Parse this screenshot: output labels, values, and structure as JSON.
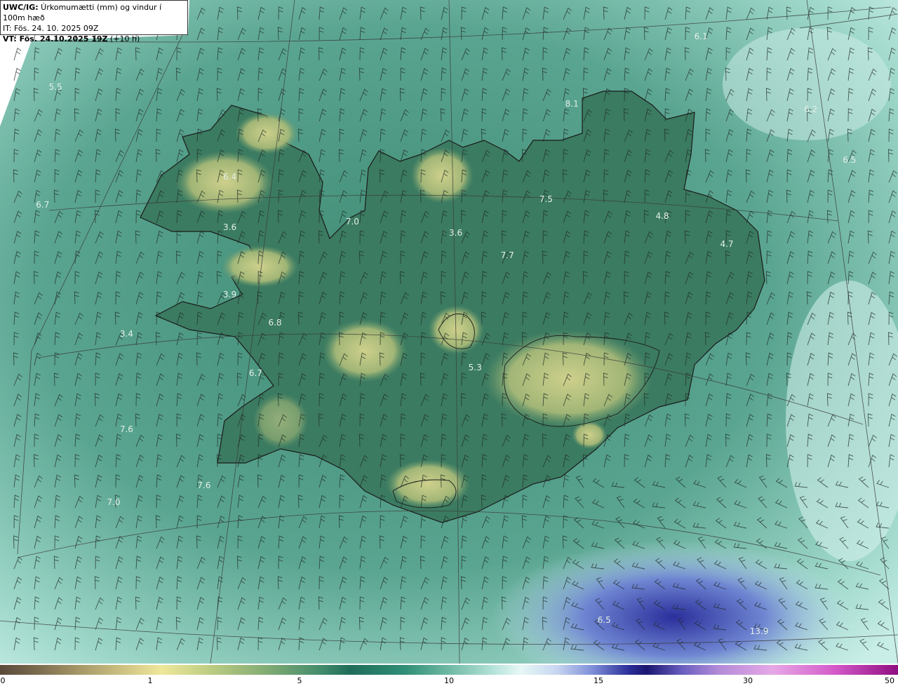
{
  "header": {
    "line1_bold": "UWC/IG:",
    "line1_rest": " Úrkomumætti (mm) og vindur í 100m hæð",
    "line2": "IT: Fös. 24. 10. 2025 09Z",
    "line3_bold": "VT: Fös. 24.10.2025 19Z",
    "line3_rest": " (+10 h)"
  },
  "value_labels": [
    {
      "text": "6.1",
      "lon": -14.9,
      "lat": 67.4
    },
    {
      "text": "5.5",
      "lon": -24.9,
      "lat": 66.95
    },
    {
      "text": "6.2",
      "lon": -13.2,
      "lat": 66.75
    },
    {
      "text": "6.5",
      "lon": -12.6,
      "lat": 66.3
    },
    {
      "text": "8.1",
      "lon": -16.9,
      "lat": 66.8
    },
    {
      "text": "6.4",
      "lon": -22.2,
      "lat": 66.15
    },
    {
      "text": "6.7",
      "lon": -25.1,
      "lat": 65.9
    },
    {
      "text": "3.6",
      "lon": -22.2,
      "lat": 65.7
    },
    {
      "text": "7.0",
      "lon": -20.3,
      "lat": 65.75
    },
    {
      "text": "3.6",
      "lon": -18.7,
      "lat": 65.65
    },
    {
      "text": "7.5",
      "lon": -17.3,
      "lat": 65.95
    },
    {
      "text": "4.8",
      "lon": -15.5,
      "lat": 65.8
    },
    {
      "text": "4.7",
      "lon": -14.5,
      "lat": 65.55
    },
    {
      "text": "7.7",
      "lon": -17.9,
      "lat": 65.45
    },
    {
      "text": "3.9",
      "lon": -22.2,
      "lat": 65.1
    },
    {
      "text": "6.8",
      "lon": -21.5,
      "lat": 64.85
    },
    {
      "text": "3.4",
      "lon": -23.8,
      "lat": 64.75
    },
    {
      "text": "5.3",
      "lon": -18.4,
      "lat": 64.45
    },
    {
      "text": "6.7",
      "lon": -21.8,
      "lat": 64.4
    },
    {
      "text": "7.6",
      "lon": -23.8,
      "lat": 63.9
    },
    {
      "text": "7.6",
      "lon": -22.6,
      "lat": 63.4
    },
    {
      "text": "7.0",
      "lon": -24.0,
      "lat": 63.25
    },
    {
      "text": "6.5",
      "lon": -16.4,
      "lat": 62.2
    },
    {
      "text": "13.9",
      "lon": -14.0,
      "lat": 62.1
    }
  ],
  "colors": {
    "sea": "#4f9c86",
    "land": "#3e7f63",
    "highland": "#b8c27a",
    "coast": "#1a1a1a",
    "grid": "#3a3a3a",
    "barb": "#1f2b25"
  },
  "colorbar": {
    "ticks": [
      "0",
      "1",
      "5",
      "10",
      "15",
      "30",
      "50"
    ]
  }
}
